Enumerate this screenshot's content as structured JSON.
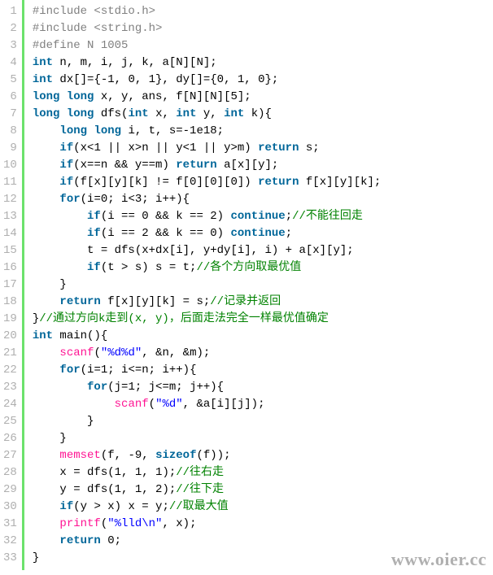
{
  "watermark": "www.oier.cc",
  "lines": [
    {
      "n": "1",
      "tokens": [
        {
          "c": "preproc",
          "t": "#include <stdio.h>"
        }
      ]
    },
    {
      "n": "2",
      "tokens": [
        {
          "c": "preproc",
          "t": "#include <string.h>"
        }
      ]
    },
    {
      "n": "3",
      "tokens": [
        {
          "c": "preproc",
          "t": "#define N 1005"
        }
      ]
    },
    {
      "n": "4",
      "tokens": [
        {
          "c": "kw",
          "t": "int"
        },
        {
          "c": "plain",
          "t": " n, m, i, j, k, a[N][N];"
        }
      ]
    },
    {
      "n": "5",
      "tokens": [
        {
          "c": "kw",
          "t": "int"
        },
        {
          "c": "plain",
          "t": " dx[]={-1, 0, 1}, dy[]={0, 1, 0};"
        }
      ]
    },
    {
      "n": "6",
      "tokens": [
        {
          "c": "kw",
          "t": "long"
        },
        {
          "c": "plain",
          "t": " "
        },
        {
          "c": "kw",
          "t": "long"
        },
        {
          "c": "plain",
          "t": " x, y, ans, f[N][N][5];"
        }
      ]
    },
    {
      "n": "7",
      "tokens": [
        {
          "c": "kw",
          "t": "long"
        },
        {
          "c": "plain",
          "t": " "
        },
        {
          "c": "kw",
          "t": "long"
        },
        {
          "c": "plain",
          "t": " dfs("
        },
        {
          "c": "kw",
          "t": "int"
        },
        {
          "c": "plain",
          "t": " x, "
        },
        {
          "c": "kw",
          "t": "int"
        },
        {
          "c": "plain",
          "t": " y, "
        },
        {
          "c": "kw",
          "t": "int"
        },
        {
          "c": "plain",
          "t": " k){"
        }
      ]
    },
    {
      "n": "8",
      "tokens": [
        {
          "c": "plain",
          "t": "    "
        },
        {
          "c": "kw",
          "t": "long"
        },
        {
          "c": "plain",
          "t": " "
        },
        {
          "c": "kw",
          "t": "long"
        },
        {
          "c": "plain",
          "t": " i, t, s=-1e18;"
        }
      ]
    },
    {
      "n": "9",
      "tokens": [
        {
          "c": "plain",
          "t": "    "
        },
        {
          "c": "kw",
          "t": "if"
        },
        {
          "c": "plain",
          "t": "(x<1 || x>n || y<1 || y>m) "
        },
        {
          "c": "kw",
          "t": "return"
        },
        {
          "c": "plain",
          "t": " s;"
        }
      ]
    },
    {
      "n": "10",
      "tokens": [
        {
          "c": "plain",
          "t": "    "
        },
        {
          "c": "kw",
          "t": "if"
        },
        {
          "c": "plain",
          "t": "(x==n && y==m) "
        },
        {
          "c": "kw",
          "t": "return"
        },
        {
          "c": "plain",
          "t": " a[x][y];"
        }
      ]
    },
    {
      "n": "11",
      "tokens": [
        {
          "c": "plain",
          "t": "    "
        },
        {
          "c": "kw",
          "t": "if"
        },
        {
          "c": "plain",
          "t": "(f[x][y][k] != f[0][0][0]) "
        },
        {
          "c": "kw",
          "t": "return"
        },
        {
          "c": "plain",
          "t": " f[x][y][k];"
        }
      ]
    },
    {
      "n": "12",
      "tokens": [
        {
          "c": "plain",
          "t": "    "
        },
        {
          "c": "kw",
          "t": "for"
        },
        {
          "c": "plain",
          "t": "(i=0; i<3; i++){"
        }
      ]
    },
    {
      "n": "13",
      "tokens": [
        {
          "c": "plain",
          "t": "        "
        },
        {
          "c": "kw",
          "t": "if"
        },
        {
          "c": "plain",
          "t": "(i == 0 && k == 2) "
        },
        {
          "c": "kw",
          "t": "continue"
        },
        {
          "c": "plain",
          "t": ";"
        },
        {
          "c": "cmt",
          "t": "//不能往回走"
        }
      ]
    },
    {
      "n": "14",
      "tokens": [
        {
          "c": "plain",
          "t": "        "
        },
        {
          "c": "kw",
          "t": "if"
        },
        {
          "c": "plain",
          "t": "(i == 2 && k == 0) "
        },
        {
          "c": "kw",
          "t": "continue"
        },
        {
          "c": "plain",
          "t": ";"
        }
      ]
    },
    {
      "n": "15",
      "tokens": [
        {
          "c": "plain",
          "t": "        t = dfs(x+dx[i], y+dy[i], i) + a[x][y];"
        }
      ]
    },
    {
      "n": "16",
      "tokens": [
        {
          "c": "plain",
          "t": "        "
        },
        {
          "c": "kw",
          "t": "if"
        },
        {
          "c": "plain",
          "t": "(t > s) s = t;"
        },
        {
          "c": "cmt",
          "t": "//各个方向取最优值"
        }
      ]
    },
    {
      "n": "17",
      "tokens": [
        {
          "c": "plain",
          "t": "    }"
        }
      ]
    },
    {
      "n": "18",
      "tokens": [
        {
          "c": "plain",
          "t": "    "
        },
        {
          "c": "kw",
          "t": "return"
        },
        {
          "c": "plain",
          "t": " f[x][y][k] = s;"
        },
        {
          "c": "cmt",
          "t": "//记录并返回"
        }
      ]
    },
    {
      "n": "19",
      "tokens": [
        {
          "c": "plain",
          "t": "}"
        },
        {
          "c": "cmt",
          "t": "//通过方向k走到(x, y)，后面走法完全一样最优值确定"
        }
      ]
    },
    {
      "n": "20",
      "tokens": [
        {
          "c": "kw",
          "t": "int"
        },
        {
          "c": "plain",
          "t": " main(){"
        }
      ]
    },
    {
      "n": "21",
      "tokens": [
        {
          "c": "plain",
          "t": "    "
        },
        {
          "c": "func",
          "t": "scanf"
        },
        {
          "c": "plain",
          "t": "("
        },
        {
          "c": "str",
          "t": "\"%d%d\""
        },
        {
          "c": "plain",
          "t": ", &n, &m);"
        }
      ]
    },
    {
      "n": "22",
      "tokens": [
        {
          "c": "plain",
          "t": "    "
        },
        {
          "c": "kw",
          "t": "for"
        },
        {
          "c": "plain",
          "t": "(i=1; i<=n; i++){"
        }
      ]
    },
    {
      "n": "23",
      "tokens": [
        {
          "c": "plain",
          "t": "        "
        },
        {
          "c": "kw",
          "t": "for"
        },
        {
          "c": "plain",
          "t": "(j=1; j<=m; j++){"
        }
      ]
    },
    {
      "n": "24",
      "tokens": [
        {
          "c": "plain",
          "t": "            "
        },
        {
          "c": "func",
          "t": "scanf"
        },
        {
          "c": "plain",
          "t": "("
        },
        {
          "c": "str",
          "t": "\"%d\""
        },
        {
          "c": "plain",
          "t": ", &a[i][j]);"
        }
      ]
    },
    {
      "n": "25",
      "tokens": [
        {
          "c": "plain",
          "t": "        }"
        }
      ]
    },
    {
      "n": "26",
      "tokens": [
        {
          "c": "plain",
          "t": "    }"
        }
      ]
    },
    {
      "n": "27",
      "tokens": [
        {
          "c": "plain",
          "t": "    "
        },
        {
          "c": "func",
          "t": "memset"
        },
        {
          "c": "plain",
          "t": "(f, -9, "
        },
        {
          "c": "kw",
          "t": "sizeof"
        },
        {
          "c": "plain",
          "t": "(f));"
        }
      ]
    },
    {
      "n": "28",
      "tokens": [
        {
          "c": "plain",
          "t": "    x = dfs(1, 1, 1);"
        },
        {
          "c": "cmt",
          "t": "//往右走"
        }
      ]
    },
    {
      "n": "29",
      "tokens": [
        {
          "c": "plain",
          "t": "    y = dfs(1, 1, 2);"
        },
        {
          "c": "cmt",
          "t": "//往下走"
        }
      ]
    },
    {
      "n": "30",
      "tokens": [
        {
          "c": "plain",
          "t": "    "
        },
        {
          "c": "kw",
          "t": "if"
        },
        {
          "c": "plain",
          "t": "(y > x) x = y;"
        },
        {
          "c": "cmt",
          "t": "//取最大值"
        }
      ]
    },
    {
      "n": "31",
      "tokens": [
        {
          "c": "plain",
          "t": "    "
        },
        {
          "c": "func",
          "t": "printf"
        },
        {
          "c": "plain",
          "t": "("
        },
        {
          "c": "str",
          "t": "\"%lld\\n\""
        },
        {
          "c": "plain",
          "t": ", x);"
        }
      ]
    },
    {
      "n": "32",
      "tokens": [
        {
          "c": "plain",
          "t": "    "
        },
        {
          "c": "kw",
          "t": "return"
        },
        {
          "c": "plain",
          "t": " 0;"
        }
      ]
    },
    {
      "n": "33",
      "tokens": [
        {
          "c": "plain",
          "t": "}"
        }
      ]
    }
  ]
}
